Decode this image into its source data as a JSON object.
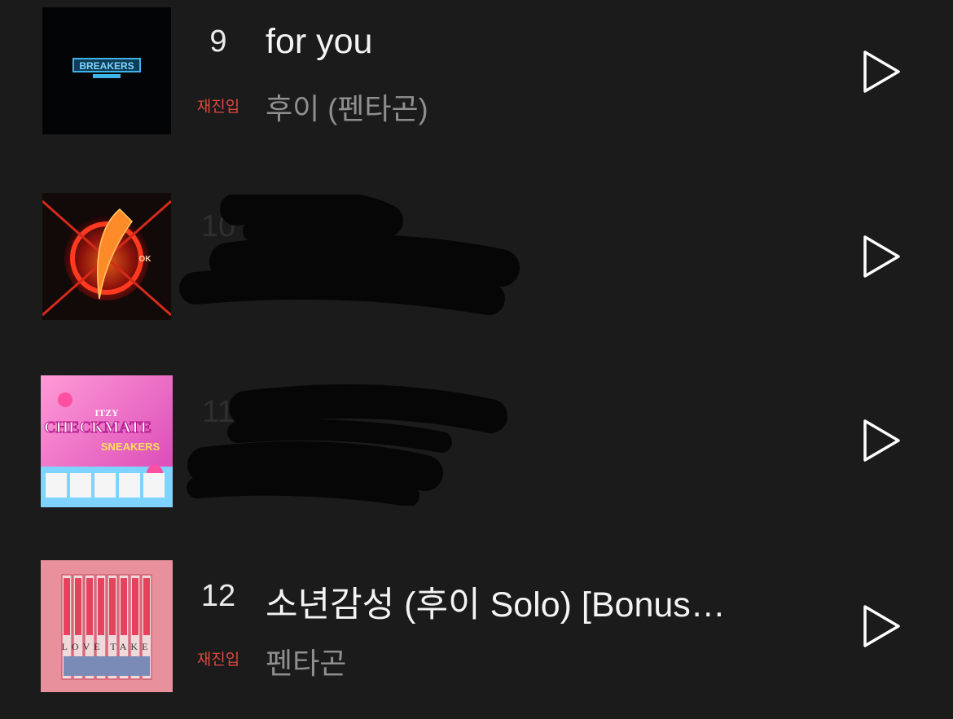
{
  "chart": {
    "items": [
      {
        "rank": "9",
        "status": "재진입",
        "title": "for you",
        "artist": "후이 (펜타곤)",
        "cover_text": "BREAKERS"
      },
      {
        "rank": "10",
        "status": "",
        "title": "",
        "artist": "",
        "cover_text": "OK"
      },
      {
        "rank": "11",
        "status": "",
        "title": "",
        "artist": "",
        "cover_text_top": "ITZY",
        "cover_text": "CHECKMATE",
        "cover_text_sub": "SNEAKERS"
      },
      {
        "rank": "12",
        "status": "재진입",
        "title": "소년감성 (후이 Solo) [Bonus…",
        "artist": "펜타곤",
        "cover_text": "LOVE TAKE"
      }
    ]
  },
  "icons": {
    "play": "play-icon"
  },
  "colors": {
    "background": "#1b1b1c",
    "reentry": "#e0463c",
    "title": "#f4f4f4",
    "artist": "#8f8f8f"
  }
}
